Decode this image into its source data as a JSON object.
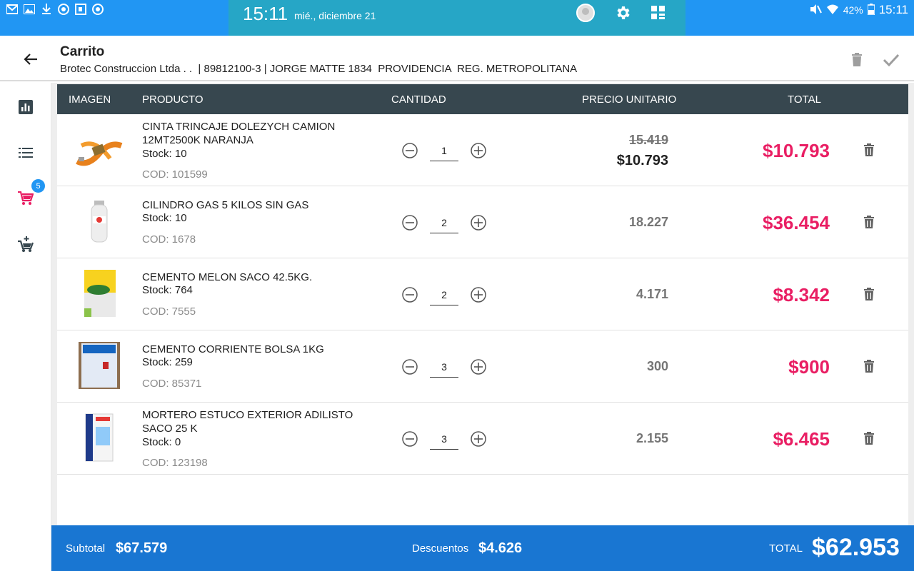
{
  "statusbar": {
    "time": "15:11",
    "date": "mié., diciembre 21",
    "battery": "42%",
    "clock": "15:11"
  },
  "appbar": {
    "title": "Carrito",
    "subtitle": "Brotec Construccion Ltda . .  | 89812100-3 | JORGE MATTE 1834  PROVIDENCIA  REG. METROPOLITANA"
  },
  "sidenav": {
    "cart_badge": "5"
  },
  "table": {
    "headers": {
      "imagen": "IMAGEN",
      "producto": "PRODUCTO",
      "cantidad": "CANTIDAD",
      "precio": "PRECIO UNITARIO",
      "total": "TOTAL"
    },
    "rows": [
      {
        "name": "CINTA TRINCAJE DOLEZYCH CAMION 12MT2500K NARANJA",
        "stock": "Stock: 10",
        "cod": "COD: 101599",
        "qty": "1",
        "unit_old": "15.419",
        "unit_new": "$10.793",
        "total": "$10.793",
        "img": "orange-strap"
      },
      {
        "name": "CILINDRO GAS   5 KILOS SIN GAS",
        "stock": "Stock: 10",
        "cod": "COD: 1678",
        "qty": "2",
        "unit": "18.227",
        "total": "$36.454",
        "img": "gas-cylinder"
      },
      {
        "name": "CEMENTO MELON SACO 42.5KG.",
        "stock": "Stock: 764",
        "cod": "COD: 7555",
        "qty": "2",
        "unit": "4.171",
        "total": "$8.342",
        "img": "cement-bag-yellow"
      },
      {
        "name": "CEMENTO CORRIENTE BOLSA 1KG",
        "stock": "Stock: 259",
        "cod": "COD: 85371",
        "qty": "3",
        "unit": "300",
        "total": "$900",
        "img": "cement-bag-white"
      },
      {
        "name": "MORTERO ESTUCO EXTERIOR ADILISTO SACO 25 K",
        "stock": "Stock: 0",
        "cod": "COD: 123198",
        "qty": "3",
        "unit": "2.155",
        "total": "$6.465",
        "img": "mortar-bag"
      }
    ]
  },
  "footer": {
    "subtotal_label": "Subtotal",
    "subtotal": "$67.579",
    "discount_label": "Descuentos",
    "discount": "$4.626",
    "total_label": "TOTAL",
    "total": "$62.953"
  },
  "colors": {
    "statusbar": "#2196f3",
    "quickpanel": "#26a6c6",
    "header": "#37474f",
    "accent_total": "#e91e63",
    "footer": "#1976d2"
  }
}
